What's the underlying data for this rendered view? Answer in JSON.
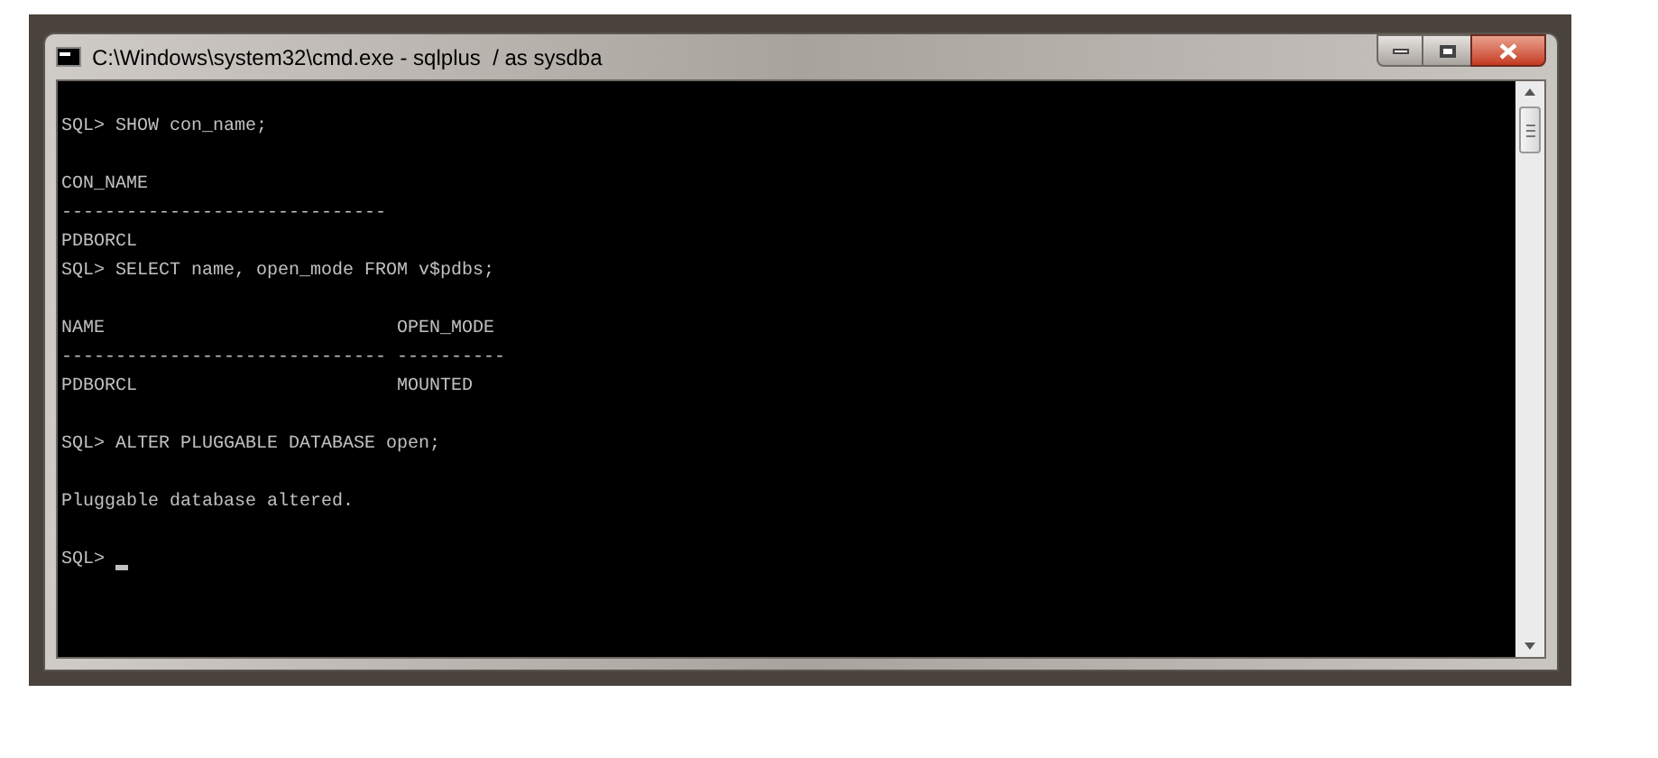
{
  "window": {
    "title": "C:\\Windows\\system32\\cmd.exe - sqlplus  / as sysdba"
  },
  "console": {
    "lines": [
      {
        "kind": "blank"
      },
      {
        "kind": "text",
        "text": "SQL> SHOW con_name;"
      },
      {
        "kind": "blank"
      },
      {
        "kind": "text",
        "text": "CON_NAME"
      },
      {
        "kind": "text",
        "text": "------------------------------"
      },
      {
        "kind": "text",
        "text": "PDBORCL"
      },
      {
        "kind": "text",
        "text": "SQL> SELECT name, open_mode FROM v$pdbs;"
      },
      {
        "kind": "blank"
      },
      {
        "kind": "row",
        "cells": [
          "NAME",
          "OPEN_MODE"
        ]
      },
      {
        "kind": "row",
        "cells": [
          "------------------------------",
          "----------"
        ]
      },
      {
        "kind": "row",
        "cells": [
          "PDBORCL",
          "MOUNTED"
        ]
      },
      {
        "kind": "blank"
      },
      {
        "kind": "text",
        "text": "SQL> ALTER PLUGGABLE DATABASE open;"
      },
      {
        "kind": "blank"
      },
      {
        "kind": "text",
        "text": "Pluggable database altered."
      },
      {
        "kind": "blank"
      },
      {
        "kind": "prompt",
        "text": "SQL>"
      }
    ]
  }
}
